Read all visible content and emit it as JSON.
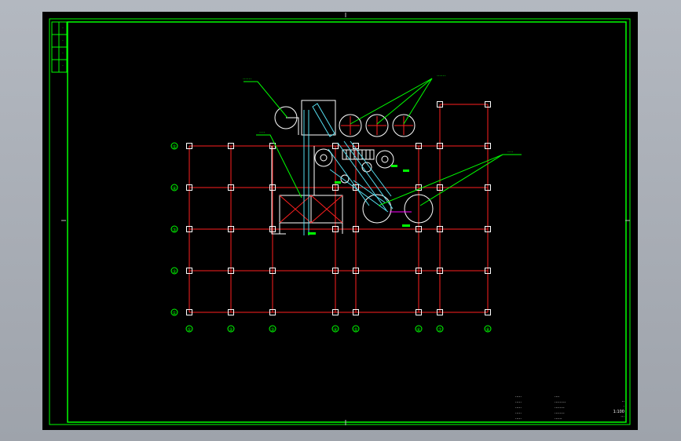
{
  "drawing": {
    "background": "#000000",
    "frame_color": "#00ff00",
    "grid_color": "#ff2020",
    "column_marker_color": "#ffffff",
    "leader_color": "#00ff00",
    "pipe_color": "#55ddee",
    "dimension_color": "#ff00ff"
  },
  "grid": {
    "x_labels": [
      "①",
      "②",
      "③",
      "④",
      "⑤",
      "⑥",
      "⑦",
      "⑧"
    ],
    "y_labels": [
      "⑤",
      "④",
      "③",
      "②",
      "①"
    ]
  },
  "callouts": {
    "top_left": "······",
    "top_right": "······",
    "left_middle": "····",
    "right_middle": "····"
  },
  "title_block": {
    "col1": [
      "·····",
      "·····",
      "·····",
      "·····",
      "·····"
    ],
    "col2": [
      "····",
      "·········",
      "········",
      "········",
      "······"
    ],
    "col3": [
      "··",
      "·",
      "1:100",
      "···"
    ]
  },
  "side_strip": [
    "·",
    "·",
    "·",
    "·"
  ]
}
